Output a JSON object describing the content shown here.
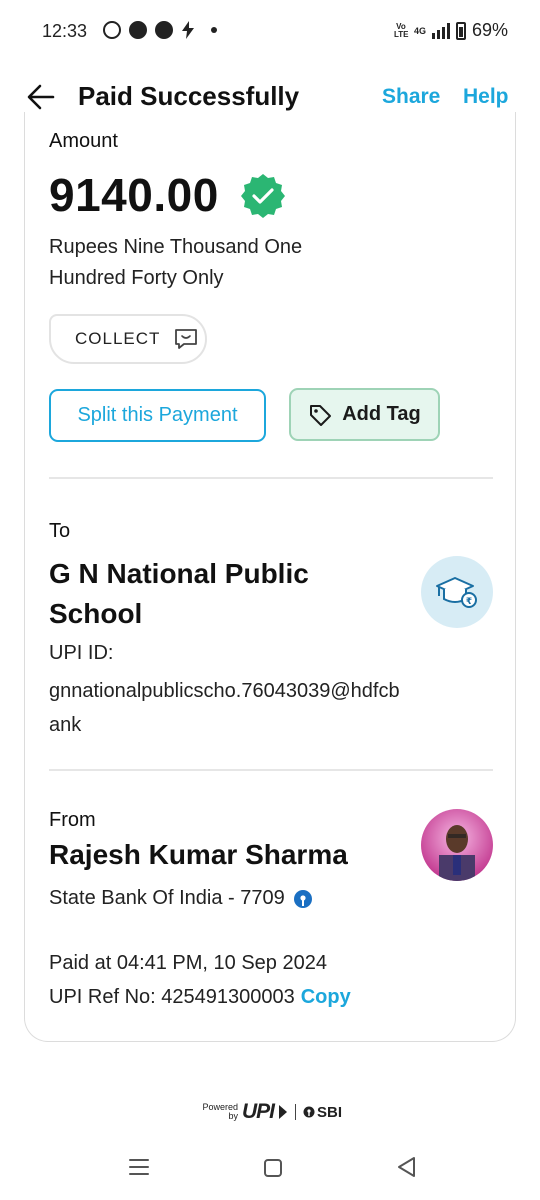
{
  "status_bar": {
    "time": "12:33",
    "battery_percent": "69%",
    "network": "4G",
    "volte": "Vo LTE"
  },
  "header": {
    "title": "Paid Successfully",
    "share_label": "Share",
    "help_label": "Help"
  },
  "amount": {
    "label": "Amount",
    "value": "9140.00",
    "words": "Rupees Nine Thousand One Hundred Forty Only",
    "status_icon": "verified-check-icon"
  },
  "collect_chip": {
    "label": "COLLECT",
    "icon": "message-icon"
  },
  "actions": {
    "split_label": "Split this Payment",
    "tag_label": "Add Tag"
  },
  "to": {
    "label": "To",
    "name": "G N National Public School",
    "upi_label": "UPI ID:",
    "upi_id": "gnnationalpublicscho.76043039@hdfcbank",
    "avatar_icon": "graduation-cap-icon"
  },
  "from": {
    "label": "From",
    "name": "Rajesh Kumar Sharma",
    "bank": "State Bank Of India - 7709",
    "bank_icon": "sbi-logo-icon"
  },
  "meta": {
    "paid_at": "Paid at 04:41 PM, 10 Sep 2024",
    "ref_label": "UPI Ref No: 425491300003",
    "copy_label": "Copy"
  },
  "footer": {
    "powered_by": "Powered by",
    "upi_text": "UPI",
    "sbi_text": "SBI"
  },
  "colors": {
    "accent": "#1ca7dc",
    "success": "#2bb673",
    "tag_bg": "#e6f6ee"
  }
}
